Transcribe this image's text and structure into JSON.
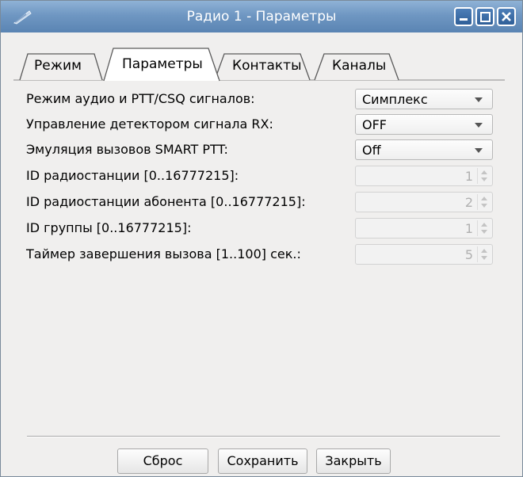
{
  "window": {
    "title": "Радио 1 - Параметры"
  },
  "tabs": [
    {
      "label": "Режим",
      "active": false
    },
    {
      "label": "Параметры",
      "active": true
    },
    {
      "label": "Контакты",
      "active": false
    },
    {
      "label": "Каналы",
      "active": false
    }
  ],
  "settings": {
    "audio_mode": {
      "label": "Режим аудио и PTT/CSQ сигналов:",
      "value": "Симплекс"
    },
    "rx_detector": {
      "label": "Управление детектором сигнала RX:",
      "value": "OFF"
    },
    "smart_ptt": {
      "label": "Эмуляция вызовов SMART PTT:",
      "value": "Off"
    },
    "radio_id": {
      "label": "ID радиостанции [0..16777215]:",
      "value": "1"
    },
    "subscriber_id": {
      "label": "ID радиостанции абонента [0..16777215]:",
      "value": "2"
    },
    "group_id": {
      "label": "ID группы [0..16777215]:",
      "value": "1"
    },
    "call_timer": {
      "label": "Таймер завершения вызова [1..100] сек.:",
      "value": "5"
    }
  },
  "buttons": {
    "reset": "Сброс",
    "save": "Сохранить",
    "close": "Закрыть"
  },
  "colors": {
    "titlebar": "#6f97c2",
    "background": "#f0efee"
  }
}
